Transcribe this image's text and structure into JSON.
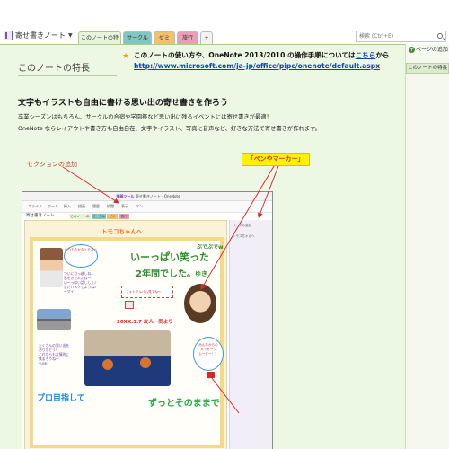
{
  "header": {
    "notebook_name": "寄せ書きノート",
    "search_placeholder": "検索 (Ctrl+E)",
    "tabs": [
      {
        "label": "このノートの特長"
      },
      {
        "label": "サークル"
      },
      {
        "label": "ゼミ"
      },
      {
        "label": "旅行"
      },
      {
        "label": "+"
      }
    ]
  },
  "page": {
    "title": "このノートの特長",
    "info_line1_prefix": "このノートの使い方や、OneNote 2013/2010 の操作手順については",
    "info_line1_link": "こちら",
    "info_line1_suffix": "から",
    "info_line2_url": "http://www.microsoft.com/ja-jp/office/pipc/onenote/default.aspx",
    "heading": "文字もイラストも自由に書ける思い出の寄せ書きを作ろう",
    "body_line1": "卒業シーズンはもちろん、サークルの合宿や学園祭など思い出に残るイベントには寄せ書きが最適！",
    "body_line2": "OneNote ならレイアウトや書き方も自由自在、文字やイラスト、写真に音声など、好きな方法で寄せ書きが作れます。",
    "callout_section": "セクションの追加",
    "callout_pen": "「ペンやマーカー」"
  },
  "embedded": {
    "window_title": "寄せ書きノート - OneNote",
    "title_highlight": "描画ツール",
    "ribbon_items": [
      "ファイル",
      "ホーム",
      "挿入",
      "描画",
      "履歴",
      "校閲",
      "表示",
      "ペン"
    ],
    "notebook_name": "寄せ書きノート",
    "tabs": [
      "このノートの特長",
      "サークル",
      "ゼミ",
      "旅行"
    ],
    "page_heading": "トモコちゃんへ",
    "side_items": [
      "ページの追加",
      "トモコちゃんへ"
    ],
    "bubble1": [
      "いつもおかなトモコへ",
      "♡"
    ],
    "note1": [
      "ついに引っ越しね…",
      "息をきたれだね〜",
      "い〜っぱい話しした♪",
      "またバスケしようね♪",
      "～マイ"
    ],
    "hand1": "いーっぱい笑った",
    "hand2": "2年間でした。",
    "hand_small": "ゆき",
    "hand_top": "ぶでぶでw",
    "album_text": "フォトアルバム見てね～",
    "date_line": "20XX.3.7 友人一同より",
    "note2": [
      "たくさんの思い出を",
      "ありがとう！",
      "これからも友情的に",
      "集まろうね～",
      "YUMI"
    ],
    "bubble2": [
      "みんなからの",
      "メッセージ",
      "ムービー！！"
    ],
    "hand4": "プロ目指して",
    "hand5": "ずっとそのままで"
  },
  "right_panel": {
    "add_page": "ページの追加",
    "page_item": "このノートの特長"
  },
  "colors": {
    "page_bg": "#edf8e4",
    "tab_circle": "#7fc6c4",
    "tab_seminar": "#f0c16e",
    "tab_travel": "#e89fb7",
    "callout_red": "#c0392b",
    "highlight_yellow": "#fff200",
    "link_blue": "#0b46b8"
  },
  "icons": {
    "notebook": "notebook-icon",
    "search": "search-icon",
    "star": "star-icon",
    "add_page": "plus-icon"
  }
}
